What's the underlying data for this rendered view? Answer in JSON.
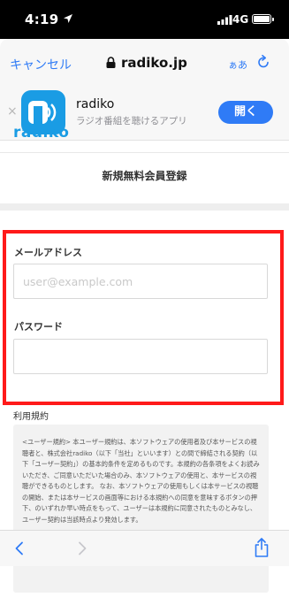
{
  "status_bar": {
    "time": "4:19",
    "network": "4G"
  },
  "browser": {
    "cancel_label": "キャンセル",
    "url": "radiko.jp",
    "text_size_label": "ぁあ"
  },
  "app_banner": {
    "app_name": "radiko",
    "app_description": "ラジオ番組を聴けるアプリ",
    "open_label": "開く",
    "close_glyph": "×"
  },
  "page": {
    "logo_text": "radiko",
    "title": "新規無料会員登録",
    "email_label": "メールアドレス",
    "email_placeholder": "user@example.com",
    "password_label": "パスワード",
    "terms_label": "利用規約",
    "terms_text": "<ユーザー規約> 本ユーザー規約は、本ソフトウェアの使用者及び本サービスの視聴者と、株式会社radiko（以下「当社」といいます）との間で締結される契約（以下「ユーザー契約」）の基本的条件を定めるものです。本規約の各条項をよくお読みいただき、ご同意いただいた場合のみ、本ソフトウェアの使用と、本サービスの視聴ができるものとします。 なお、本ソフトウェアの使用もしくは本サービスの視聴の開始、または本サービスの画面等における本規約への同意を意味するボタンの押下、のいずれか早い時点をもって、ユーザーは本規約に同意されたものとみなし、ユーザー契約は当該時点より発効します。"
  },
  "colors": {
    "accent": "#2f7bf6",
    "brand": "#1a9ce4",
    "highlight": "#ff1a1a"
  }
}
